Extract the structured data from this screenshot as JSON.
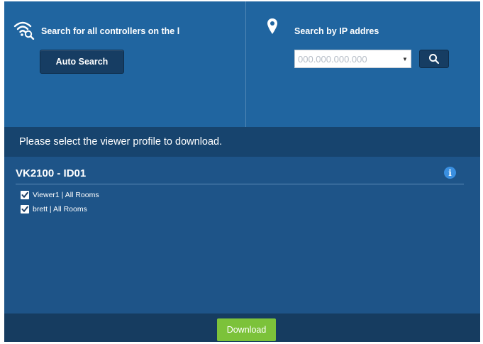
{
  "search_all": {
    "title": "Search for all controllers on the l",
    "button_label": "Auto Search",
    "icon": "wifi-search-icon"
  },
  "search_ip": {
    "title": "Search by IP addres",
    "placeholder": "000.000.000.000",
    "icon": "location-pin-icon",
    "search_icon": "search-icon"
  },
  "prompt": "Please select the viewer profile to download.",
  "device": {
    "title": "VK2100 - ID01",
    "info_icon": "info-icon",
    "profiles": [
      {
        "label": "Viewer1 | All Rooms",
        "checked": true
      },
      {
        "label": "brett | All Rooms",
        "checked": true
      }
    ]
  },
  "footer": {
    "download_label": "Download"
  },
  "colors": {
    "panel": "#2065a0",
    "prompt_band": "#17446e",
    "content": "#1e5488",
    "footer": "#163c60",
    "button_dark": "#163d63",
    "download": "#7cc23a",
    "info": "#3a8fe0"
  }
}
